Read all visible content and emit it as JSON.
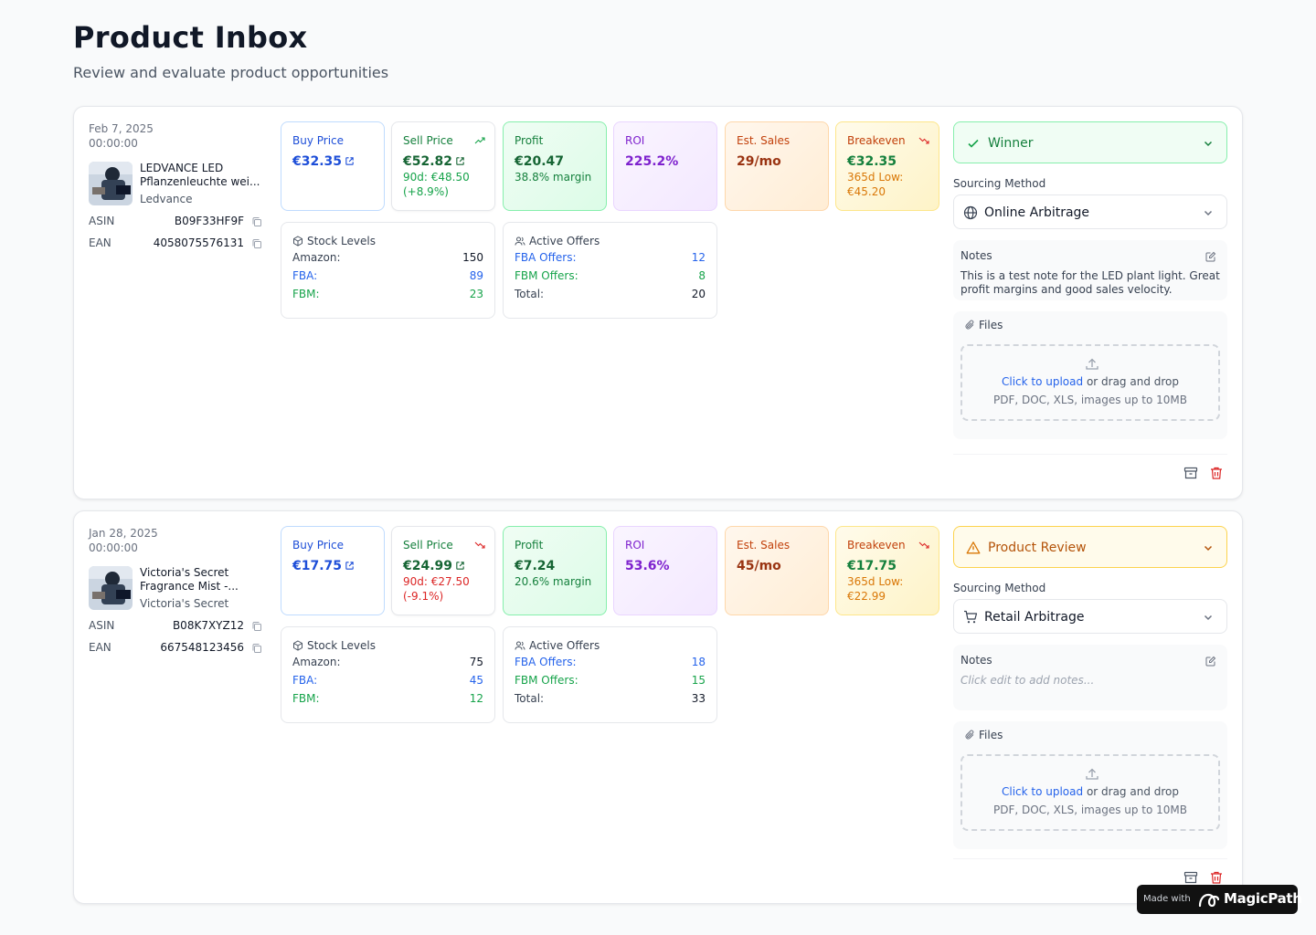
{
  "page": {
    "title": "Product Inbox",
    "subtitle": "Review and evaluate product opportunities"
  },
  "labels": {
    "buy_price": "Buy Price",
    "sell_price": "Sell Price",
    "profit": "Profit",
    "roi": "ROI",
    "est_sales": "Est. Sales",
    "breakeven": "Breakeven",
    "stock_levels": "Stock Levels",
    "active_offers": "Active Offers",
    "amazon": "Amazon:",
    "fba": "FBA:",
    "fbm": "FBM:",
    "fba_offers": "FBA Offers:",
    "fbm_offers": "FBM Offers:",
    "total": "Total:",
    "asin": "ASIN",
    "ean": "EAN",
    "sourcing_method": "Sourcing Method",
    "notes": "Notes",
    "files": "Files",
    "click_to_upload": "Click to upload",
    "or_drag": " or drag and drop",
    "file_types": "PDF, DOC, XLS, images up to 10MB"
  },
  "colors": {
    "accent_blue": "#2563eb",
    "green": "#16a34a",
    "purple": "#7e22ce",
    "orange": "#c2410c",
    "danger": "#dc2626"
  },
  "products": [
    {
      "date": "Feb 7, 2025",
      "time": "00:00:00",
      "name": "LEDVANCE LED Pflanzenleuchte wei...",
      "brand": "Ledvance",
      "asin": "B09F33HF9F",
      "ean": "4058075576131",
      "buy_price": "€32.35",
      "sell_price": "€52.82",
      "sell_trend": "up",
      "sell_90d": "90d: €48.50",
      "sell_90d_change": "(+8.9%)",
      "profit": "€20.47",
      "profit_margin": "38.8% margin",
      "roi": "225.2%",
      "est_sales": "29/mo",
      "breakeven": "€32.35",
      "breakeven_low_label": "365d Low:",
      "breakeven_low": "€45.20",
      "stock": {
        "amazon": "150",
        "fba": "89",
        "fbm": "23"
      },
      "offers": {
        "fba": "12",
        "fbm": "8",
        "total": "20"
      },
      "status": "Winner",
      "status_icon": "check-icon",
      "sourcing": "Online Arbitrage",
      "sourcing_icon": "globe-icon",
      "notes": "This is a test note for the LED plant light. Great profit margins and good sales velocity."
    },
    {
      "date": "Jan 28, 2025",
      "time": "00:00:00",
      "name": "Victoria's Secret Fragrance Mist -...",
      "brand": "Victoria's Secret",
      "asin": "B08K7XYZ12",
      "ean": "667548123456",
      "buy_price": "€17.75",
      "sell_price": "€24.99",
      "sell_trend": "down",
      "sell_90d": "90d: €27.50",
      "sell_90d_change": "(-9.1%)",
      "profit": "€7.24",
      "profit_margin": "20.6% margin",
      "roi": "53.6%",
      "est_sales": "45/mo",
      "breakeven": "€17.75",
      "breakeven_low_label": "365d Low:",
      "breakeven_low": "€22.99",
      "stock": {
        "amazon": "75",
        "fba": "45",
        "fbm": "12"
      },
      "offers": {
        "fba": "18",
        "fbm": "15",
        "total": "33"
      },
      "status": "Product Review",
      "status_icon": "alert-triangle-icon",
      "sourcing": "Retail Arbitrage",
      "sourcing_icon": "cart-icon",
      "notes_placeholder": "Click edit to add notes..."
    }
  ],
  "badge": {
    "made_with": "Made with",
    "brand": "MagicPath"
  }
}
